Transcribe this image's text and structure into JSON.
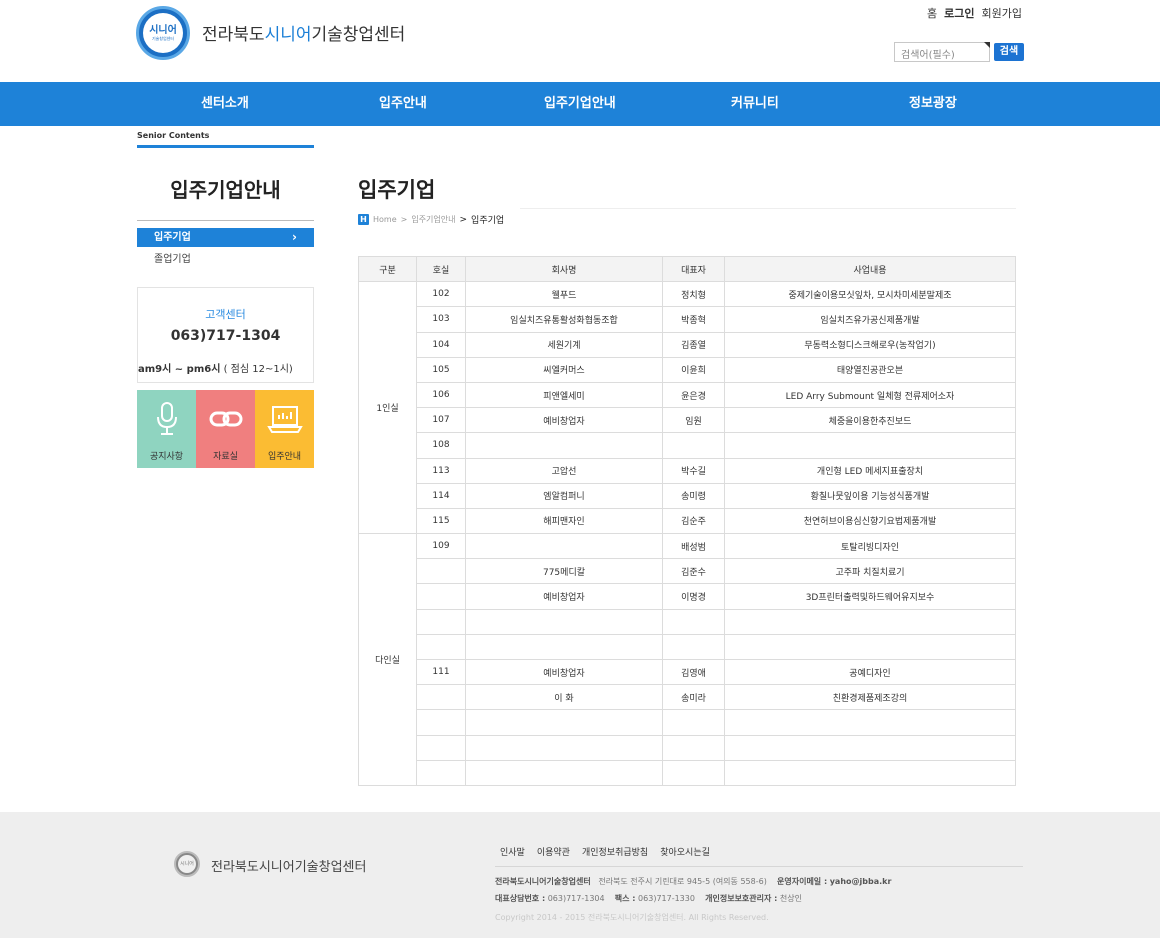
{
  "header": {
    "logo_text_big": "시니어",
    "logo_text_small": "기술창업센터",
    "site_title_pre": "전라북도",
    "site_title_hl": "시니어",
    "site_title_post": "기술창업센터",
    "top_links": {
      "home": "홈",
      "login": "로그인",
      "join": "회원가입"
    },
    "search_placeholder": "검색어(필수)",
    "search_button": "검색",
    "accent_color": "#1e82d8"
  },
  "nav": {
    "items": [
      "센터소개",
      "입주안내",
      "입주기업안내",
      "커뮤니티",
      "정보광장"
    ]
  },
  "sidebar": {
    "senior_label": "Senior Contents",
    "title": "입주기업안내",
    "menu": [
      {
        "label": "입주기업",
        "active": true
      },
      {
        "label": "졸업기업",
        "active": false
      }
    ],
    "chevron": "›",
    "customer_center": {
      "title": "고객센터",
      "phone": "063)717-1304",
      "hours_bold": "am9시 ~ pm6시",
      "hours_rest": " ( 점심 12~1시)"
    },
    "quick_buttons": [
      {
        "label": "공지사항",
        "icon": "microphone-icon",
        "color": "#8fd4c0"
      },
      {
        "label": "자료실",
        "icon": "link-icon",
        "color": "#f07f7f"
      },
      {
        "label": "입주안내",
        "icon": "laptop-icon",
        "color": "#fbbc33"
      }
    ]
  },
  "content": {
    "title": "입주기업",
    "breadcrumb": {
      "home": "Home",
      "sep1": ">",
      "parent": "입주기업안내",
      "sep2": ">",
      "current": "입주기업"
    },
    "table": {
      "headers": [
        "구분",
        "호실",
        "회사명",
        "대표자",
        "사업내용"
      ],
      "groups": [
        {
          "category": "1인실",
          "rows": [
            [
              "102",
              "웰푸드",
              "정치형",
              "중제기술이용모싯잎차, 모시차미세분말제조"
            ],
            [
              "103",
              "임실치즈유통활성화협동조합",
              "박종혁",
              "임실치즈유가공신제품개발"
            ],
            [
              "104",
              "세원기계",
              "김종열",
              "무동력소형디스크해로우(농작업기)"
            ],
            [
              "105",
              "씨엘커머스",
              "이윤희",
              "태양열진공관오븐"
            ],
            [
              "106",
              "피앤엘세미",
              "윤은경",
              "LED Arry Submount 일체형 전류제어소자"
            ],
            [
              "107",
              "예비창업자",
              "임원",
              "체중을이용한추진보드"
            ],
            [
              "108",
              "",
              "",
              ""
            ],
            [
              "113",
              "고압선",
              "박수길",
              "개인형 LED 메세지표출장치"
            ],
            [
              "114",
              "엠알컴퍼니",
              "송미령",
              "황칠나뭇잎이용 기능성식품개발"
            ],
            [
              "115",
              "해피맨자인",
              "김순주",
              "천연허브이용심신향기요법제품개발"
            ]
          ]
        },
        {
          "category": "다인실",
          "rows": [
            [
              "109",
              "",
              "배성범",
              "토탈리빙디자인"
            ],
            [
              "",
              "775메디칼",
              "김준수",
              "고주파 치질치료기"
            ],
            [
              "",
              "예비창업자",
              "이명경",
              "3D프린터출력및하드웨어유지보수"
            ],
            [
              "",
              "",
              "",
              ""
            ],
            [
              "",
              "",
              "",
              ""
            ],
            [
              "111",
              "예비창업자",
              "김영애",
              "공예디자인"
            ],
            [
              "",
              "이 화",
              "송미라",
              "친환경제품제조강의"
            ],
            [
              "",
              "",
              "",
              ""
            ],
            [
              "",
              "",
              "",
              ""
            ],
            [
              "",
              "",
              "",
              ""
            ]
          ]
        }
      ]
    }
  },
  "footer": {
    "logo_text": "시니어",
    "name": "전라북도시니어기술창업센터",
    "links": [
      "인사말",
      "이용약관",
      "개인정보취급방침",
      "찾아오시는길"
    ],
    "info1_label": "전라북도시니어기술창업센터",
    "info1_addr": "전라북도 전주시 기린대로 945-5 (여의동 558-6)",
    "info1_email_label": "운영자이메일 :",
    "info1_email": "yaho@jbba.kr",
    "info2_tel_label": "대표상담번호 :",
    "info2_tel": "063)717-1304",
    "info2_fax_label": "팩스 :",
    "info2_fax": "063)717-1330",
    "info2_mgr_label": "개인정보보호관리자 :",
    "info2_mgr": "천상인",
    "copyright": "Copyright 2014 - 2015 전라북도시니어기술창업센터. All Rights Reserved."
  }
}
